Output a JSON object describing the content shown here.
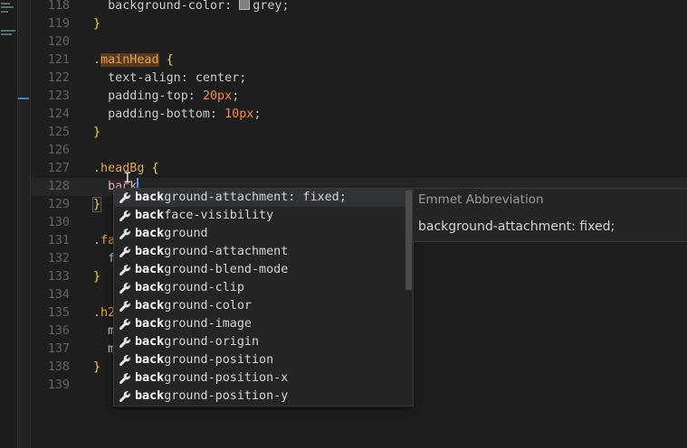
{
  "editor": {
    "lines": [
      {
        "num": "118",
        "segments": [
          {
            "t": "  background-color: ",
            "c": "prop"
          },
          {
            "t": "grey;",
            "c": "prop",
            "swatch": true
          }
        ]
      },
      {
        "num": "119",
        "segments": [
          {
            "t": "}",
            "c": "brace"
          }
        ]
      },
      {
        "num": "120",
        "segments": []
      },
      {
        "num": "121",
        "segments": [
          {
            "t": ".",
            "c": "sel"
          },
          {
            "t": "mainHead",
            "c": "sel-hl"
          },
          {
            "t": " ",
            "c": ""
          },
          {
            "t": "{",
            "c": "brace"
          }
        ]
      },
      {
        "num": "122",
        "segments": [
          {
            "t": "  text-align: center;",
            "c": "prop"
          }
        ]
      },
      {
        "num": "123",
        "segments": [
          {
            "t": "  padding-top: ",
            "c": "prop"
          },
          {
            "t": "20px",
            "c": "num"
          },
          {
            "t": ";",
            "c": "prop"
          }
        ]
      },
      {
        "num": "124",
        "segments": [
          {
            "t": "  padding-bottom: ",
            "c": "prop"
          },
          {
            "t": "10px",
            "c": "num"
          },
          {
            "t": ";",
            "c": "prop"
          }
        ]
      },
      {
        "num": "125",
        "segments": [
          {
            "t": "}",
            "c": "brace"
          }
        ]
      },
      {
        "num": "126",
        "segments": []
      },
      {
        "num": "127",
        "segments": [
          {
            "t": ".headBg ",
            "c": "sel"
          },
          {
            "t": "{",
            "c": "brace"
          }
        ]
      },
      {
        "num": "128",
        "current": true,
        "segments": [
          {
            "t": "  ",
            "c": ""
          },
          {
            "t": "back",
            "c": "prop typed-bg",
            "caret": true
          }
        ]
      },
      {
        "num": "129",
        "segments": [
          {
            "t": "}",
            "c": "brace bracket-hl"
          }
        ]
      },
      {
        "num": "130",
        "segments": []
      },
      {
        "num": "131",
        "segments": [
          {
            "t": ".fa",
            "c": "sel"
          }
        ]
      },
      {
        "num": "132",
        "segments": [
          {
            "t": "  f",
            "c": "prop"
          }
        ]
      },
      {
        "num": "133",
        "segments": [
          {
            "t": "}",
            "c": "brace"
          }
        ]
      },
      {
        "num": "134",
        "segments": []
      },
      {
        "num": "135",
        "segments": [
          {
            "t": ".h2",
            "c": "sel"
          }
        ]
      },
      {
        "num": "136",
        "segments": [
          {
            "t": "  m",
            "c": "prop"
          }
        ]
      },
      {
        "num": "137",
        "segments": [
          {
            "t": "  m",
            "c": "prop"
          }
        ]
      },
      {
        "num": "138",
        "segments": [
          {
            "t": "}",
            "c": "brace"
          }
        ]
      },
      {
        "num": "139",
        "segments": []
      }
    ]
  },
  "autocomplete": {
    "match_prefix": "back",
    "items": [
      {
        "rest": "ground-attachment: fixed;",
        "selected": true
      },
      {
        "rest": "face-visibility"
      },
      {
        "rest": "ground"
      },
      {
        "rest": "ground-attachment"
      },
      {
        "rest": "ground-blend-mode"
      },
      {
        "rest": "ground-clip"
      },
      {
        "rest": "ground-color"
      },
      {
        "rest": "ground-image"
      },
      {
        "rest": "ground-origin"
      },
      {
        "rest": "ground-position"
      },
      {
        "rest": "ground-position-x"
      },
      {
        "rest": "ground-position-y"
      }
    ],
    "icon": "wrench-icon"
  },
  "doc_panel": {
    "title": "Emmet Abbreviation",
    "body": "background-attachment: fixed;"
  },
  "colors": {
    "background": "#1e1e1e",
    "selector": "#e8a24c",
    "brace": "#ffd02e",
    "number": "#f08d49",
    "caret": "#4aa3ff"
  }
}
